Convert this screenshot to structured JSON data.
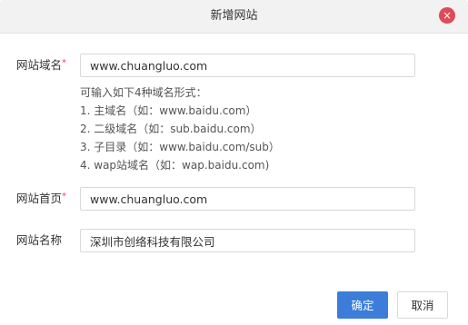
{
  "dialog": {
    "title": "新增网站",
    "close_label": "×"
  },
  "form": {
    "domain": {
      "label": "网站域名",
      "required_mark": "*",
      "value": "www.chuangluo.com"
    },
    "hint": {
      "intro": "可输入如下4种域名形式：",
      "items": [
        "1. 主域名（如：www.baidu.com）",
        "2. 二级域名（如：sub.baidu.com）",
        "3. 子目录（如：www.baidu.com/sub）",
        "4. wap站域名（如：wap.baidu.com)"
      ]
    },
    "homepage": {
      "label": "网站首页",
      "required_mark": "*",
      "value": "www.chuangluo.com"
    },
    "site_name": {
      "label": "网站名称",
      "value": "深圳市创络科技有限公司"
    }
  },
  "footer": {
    "ok_label": "确定",
    "cancel_label": "取消"
  },
  "colors": {
    "primary": "#3b7dd8",
    "danger": "#e04a58"
  }
}
